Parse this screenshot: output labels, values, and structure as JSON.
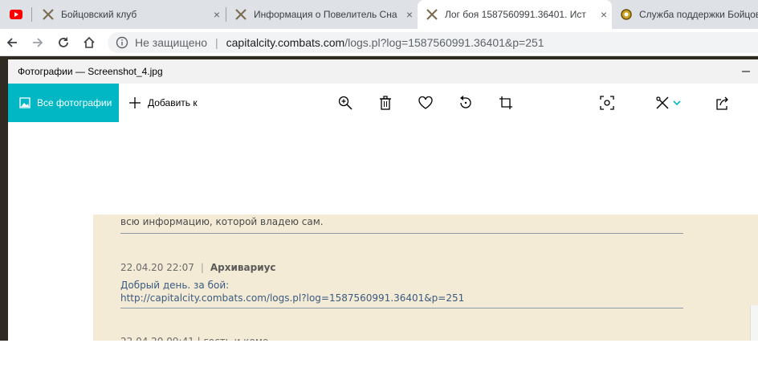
{
  "browser": {
    "tabs": [
      {
        "title": "",
        "favicon": "youtube-icon"
      },
      {
        "title": "Бойцовский клуб",
        "favicon": "crossed-swords-icon"
      },
      {
        "title": "Информация о Повелитель Сна",
        "favicon": "crossed-swords-icon"
      },
      {
        "title": "Лог боя 1587560991.36401. Ист",
        "favicon": "crossed-swords-icon"
      },
      {
        "title": "Служба поддержки Бойцовс",
        "favicon": "gear-icon"
      }
    ],
    "close_glyph": "×",
    "address": {
      "security_label": "Не защищено",
      "divider": "|",
      "url_host": "capitalcity.combats.com",
      "url_path": "/logs.pl?log=1587560991.36401&p=251"
    }
  },
  "photos_app": {
    "window_title": "Фотографии — Screenshot_4.jpg",
    "all_photos_label": "Все фотографии",
    "add_to_label": "Добавить к",
    "accent_color": "#00b7c3"
  },
  "forum": {
    "prev_tail": "всю информацию, которой владею сам.",
    "post": {
      "date": "22.04.20 22:07",
      "separator": "|",
      "author": "Архивариус",
      "line1": "Добрый день. за бой:",
      "link": "http://capitalcity.combats.com/logs.pl?log=1587560991.36401&p=251"
    },
    "next_partial": "22.04.20 09:41  |  гость и коме"
  }
}
